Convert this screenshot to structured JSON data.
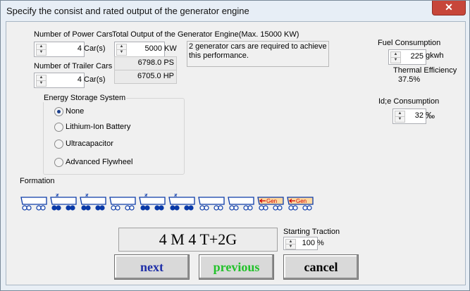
{
  "window": {
    "title": "Specify the consist and rated output of the generator engine",
    "close_label": "✕"
  },
  "power_cars": {
    "label": "Number of Power Cars",
    "value": "4",
    "unit": "Car(s)"
  },
  "total_output": {
    "label": "Total Output of the Generator Engine(Max. 15000 KW)",
    "kw_value": "5000",
    "kw_unit": "KW",
    "ps_value": "6798.0 PS",
    "hp_value": "6705.0 HP"
  },
  "info_message": "2 generator cars are required to achieve this performance.",
  "trailer_cars": {
    "label": "Number of Trailer Cars",
    "value": "4",
    "unit": "Car(s)"
  },
  "fuel": {
    "label": "Fuel Consumption",
    "value": "225",
    "unit": "gkwh",
    "thermal_label": "Thermal Efficiency",
    "thermal_value": "37.5%"
  },
  "idle": {
    "label": "Id;e Consumption",
    "value": "32",
    "unit": "‰"
  },
  "energy_storage": {
    "label": "Energy Storage System",
    "options": [
      "None",
      "Lithium-Ion Battery",
      "Ultracapacitor",
      "Advanced Flywheel"
    ],
    "selected": "None"
  },
  "formation": {
    "label": "Formation",
    "gen_label": "Gen",
    "cars": [
      "trailer",
      "power",
      "power",
      "trailer",
      "power",
      "power",
      "trailer",
      "trailer",
      "generator",
      "generator"
    ]
  },
  "consist_summary": "4 M 4 T+2G",
  "starting_traction": {
    "label": "Starting Traction",
    "value": "100",
    "unit": "%"
  },
  "buttons": {
    "next": "next",
    "previous": "previous",
    "cancel": "cancel"
  },
  "colors": {
    "next_text": "#1f2fa8",
    "previous_text": "#22c22a",
    "cancel_text": "#000000",
    "wheel": "#0a3aa8",
    "generator_fill": "#ffd9a0",
    "generator_text": "#cc0000"
  }
}
